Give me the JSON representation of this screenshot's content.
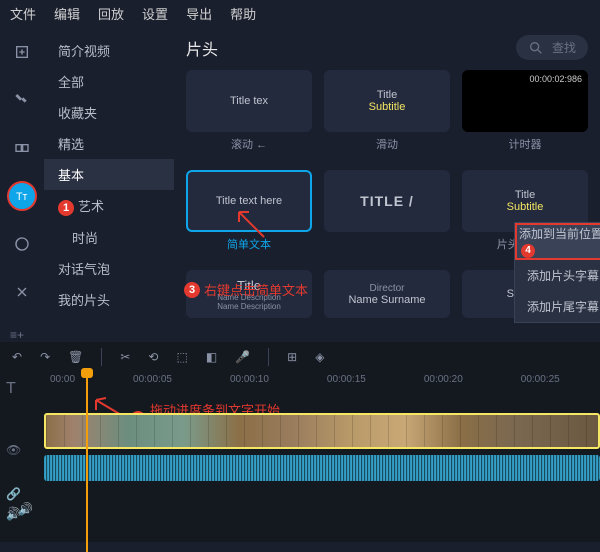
{
  "menubar": [
    "文件",
    "编辑",
    "回放",
    "设置",
    "导出",
    "帮助"
  ],
  "sidebar": {
    "items": [
      "简介视频",
      "全部",
      "收藏夹",
      "精选",
      "基本",
      "艺术",
      "时尚",
      "对话气泡",
      "我的片头"
    ],
    "selectedIndex": 4
  },
  "content": {
    "title": "片头",
    "search_placeholder": "查找"
  },
  "cards": {
    "row1": [
      {
        "main": "Title tex",
        "sub": "",
        "label": "滚动 ←"
      },
      {
        "main": "Title",
        "sub": "Subtitle",
        "label": "滑动"
      },
      {
        "main": "",
        "sub": "",
        "label": "计时器",
        "timestamp": "00:00:02:986"
      }
    ],
    "row2": [
      {
        "main": "Title text here",
        "sub": "",
        "label": "简单文本",
        "selected": true
      },
      {
        "main": "TITLE /",
        "sub": "",
        "label": ""
      },
      {
        "main": "Title",
        "sub": "Subtitle",
        "label": "片头 + 字幕"
      }
    ],
    "row3": [
      {
        "main": "Title",
        "sub": "Name Description",
        "sub2": "Name Description",
        "label": ""
      },
      {
        "main": "Director",
        "sub": "Name Surname",
        "label": ""
      },
      {
        "main": "Subtitle",
        "sub": "",
        "label": ""
      }
    ]
  },
  "context_menu": [
    "添加到当前位置",
    "添加片头字幕",
    "添加片尾字幕"
  ],
  "annotations": {
    "marker1": "1",
    "marker2": "2",
    "marker3": "3",
    "marker4": "4",
    "text2": "拖动进度条到文字开始\n出现的时间点",
    "text3": "右键点击简单文本"
  },
  "timeline": {
    "ticks": [
      "00:00",
      "00:00:05",
      "00:00:10",
      "00:00:15",
      "00:00:20",
      "00:00:25"
    ]
  }
}
